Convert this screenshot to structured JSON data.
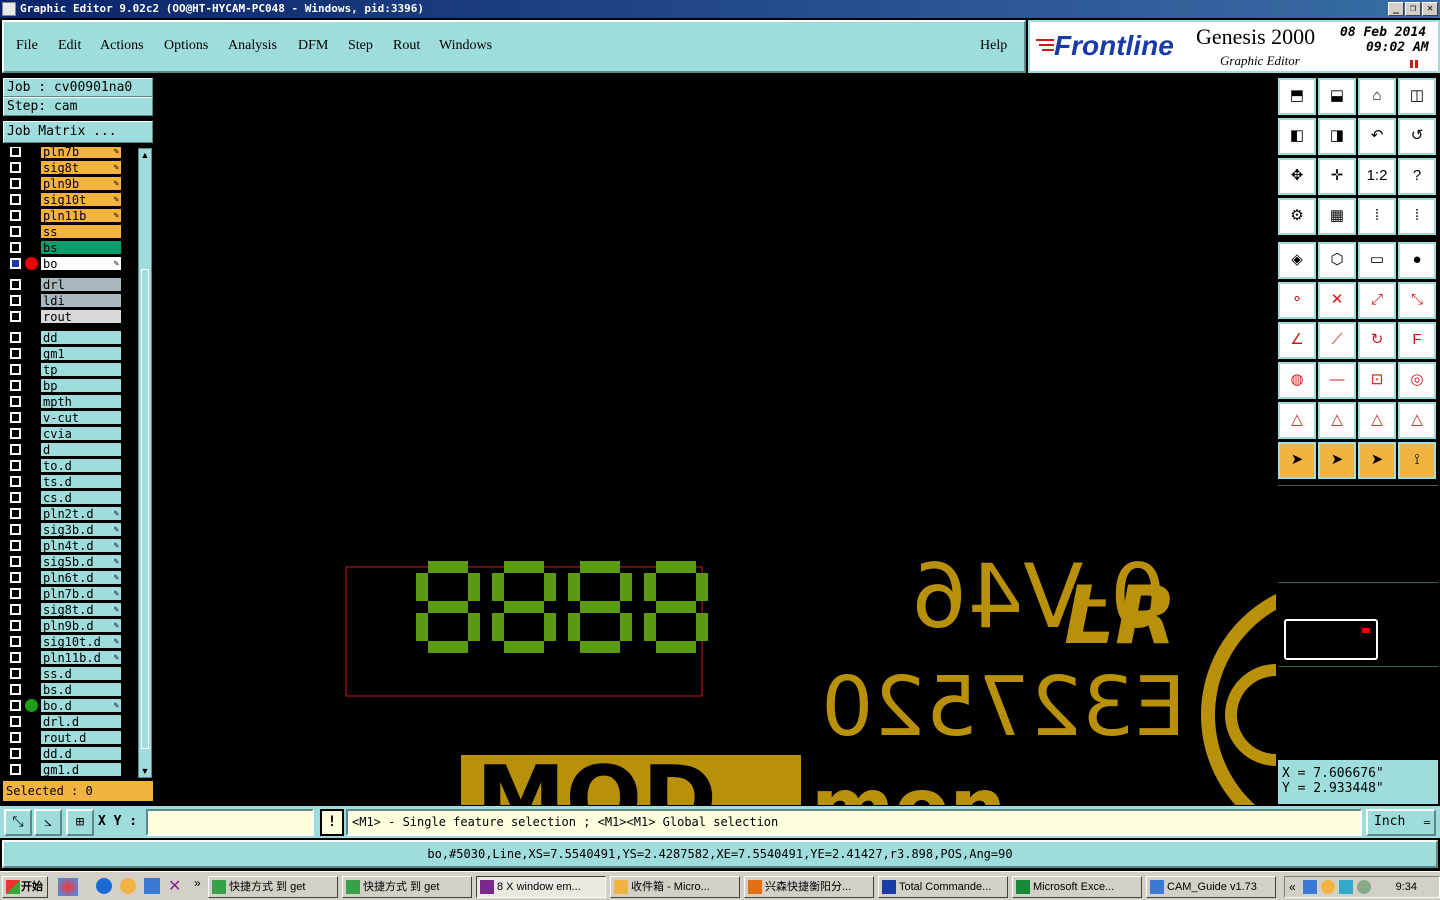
{
  "window": {
    "title": "Graphic Editor 9.02c2 (OO@HT-HYCAM-PC048 - Windows, pid:3396)",
    "controls": [
      "_",
      "❐",
      "✕"
    ]
  },
  "menu": {
    "items": [
      "File",
      "Edit",
      "Actions",
      "Options",
      "Analysis",
      "DFM",
      "Step",
      "Rout",
      "Windows"
    ],
    "help": "Help"
  },
  "logo": {
    "brand": "Frontline",
    "product": "Genesis 2000",
    "subtitle": "Graphic Editor",
    "date": "08 Feb 2014",
    "time": "09:02 AM"
  },
  "job": {
    "job_label": "Job : cv00901na0",
    "step_label": "Step: cam",
    "matrix_button": "Job Matrix ...",
    "selected": "Selected : 0"
  },
  "layers": {
    "group1": [
      {
        "name": "pln7b",
        "color": "#f2b340",
        "star": true
      },
      {
        "name": "sig8t",
        "color": "#f2b340",
        "star": true
      },
      {
        "name": "pln9b",
        "color": "#f2b340",
        "star": true
      },
      {
        "name": "sig10t",
        "color": "#f2b340",
        "star": true
      },
      {
        "name": "pln11b",
        "color": "#f2b340",
        "star": true
      },
      {
        "name": "ss",
        "color": "#f2b340",
        "star": false
      },
      {
        "name": "bs",
        "color": "#0e9e6e",
        "star": false
      },
      {
        "name": "bo",
        "color": "#ffffff",
        "star": true,
        "active": true
      }
    ],
    "group2": [
      {
        "name": "drl",
        "color": "#a9b8bc"
      },
      {
        "name": "ldi",
        "color": "#a9b8bc"
      },
      {
        "name": "rout",
        "color": "#d9d9d9"
      }
    ],
    "group3": [
      {
        "name": "dd",
        "star": false
      },
      {
        "name": "gm1",
        "star": false
      },
      {
        "name": "tp",
        "star": false
      },
      {
        "name": "bp",
        "star": false
      },
      {
        "name": "mpth",
        "star": false
      },
      {
        "name": "v-cut",
        "star": false
      },
      {
        "name": "cvia",
        "star": false
      },
      {
        "name": "d",
        "star": false
      },
      {
        "name": "to.d",
        "star": false
      },
      {
        "name": "ts.d",
        "star": false
      },
      {
        "name": "cs.d",
        "star": false
      },
      {
        "name": "pln2t.d",
        "star": true
      },
      {
        "name": "sig3b.d",
        "star": true
      },
      {
        "name": "pln4t.d",
        "star": true
      },
      {
        "name": "sig5b.d",
        "star": true
      },
      {
        "name": "pln6t.d",
        "star": true
      },
      {
        "name": "pln7b.d",
        "star": true
      },
      {
        "name": "sig8t.d",
        "star": true
      },
      {
        "name": "pln9b.d",
        "star": true
      },
      {
        "name": "sig10t.d",
        "star": true
      },
      {
        "name": "pln11b.d",
        "star": true
      },
      {
        "name": "ss.d",
        "star": false
      },
      {
        "name": "bs.d",
        "star": false
      },
      {
        "name": "bo.d",
        "star": true,
        "green": true
      },
      {
        "name": "drl.d",
        "star": false
      },
      {
        "name": "rout.d",
        "star": false
      },
      {
        "name": "dd.d",
        "star": false
      },
      {
        "name": "gm1.d",
        "star": false
      }
    ]
  },
  "canvas": {
    "digits": "8888",
    "marking_line1": "0-V46",
    "marking_line2": "E327520",
    "logo_text": "LR",
    "partial_text": "MOD",
    "colors": {
      "digits": "#5a9a14",
      "marking": "#b8900a",
      "box": "#d01818"
    }
  },
  "coords": {
    "x": "X = 7.606676\"",
    "y": "Y = 2.933448\""
  },
  "command": {
    "xy_label": "X Y :",
    "xy_value": "",
    "alert": "!",
    "prompt": "<M1> - Single feature selection ; <M1><M1> Global selection",
    "units": "Inch"
  },
  "feature_info": "bo,#5030,Line,XS=7.5540491,YS=2.4287582,XE=7.5540491,YE=2.41427,r3.898,POS,Ang=90",
  "taskbar": {
    "start": "开始",
    "tasks": [
      "快捷方式 到 get",
      "快捷方式 到 get",
      "8 X window em...",
      "收件箱 - Micro...",
      "兴森快捷衡阳分...",
      "Total Commande...",
      "Microsoft Exce...",
      "CAM_Guide v1.73"
    ],
    "clock": "9:34"
  },
  "tools": [
    "zoom-home-icon",
    "zoom-fit-icon",
    "house-icon",
    "window-icon",
    "zoom-out-icon",
    "zoom-in-icon",
    "undo-view-icon",
    "redraw-icon",
    "pan-icon",
    "center-icon",
    "scale-icon",
    "help-icon",
    "settings-icon",
    "grid-icon",
    "layer-on-icon",
    "layer-off-icon",
    "select-pad-icon",
    "select-line-icon",
    "measure-icon",
    "pad-icon",
    "node-icon",
    "cross-icon",
    "move-point-icon",
    "move-end-icon",
    "angle-icon",
    "line-icon",
    "arc-icon",
    "text-icon",
    "copy-icon",
    "minus-icon",
    "dimension-icon",
    "shapes-icon",
    "polygon-icon",
    "polygon-add-icon",
    "polygon-edit-icon",
    "polygon-cut-icon",
    "pointer-icon",
    "pointer-box-icon",
    "pointer-sel-icon",
    "route-icon"
  ]
}
